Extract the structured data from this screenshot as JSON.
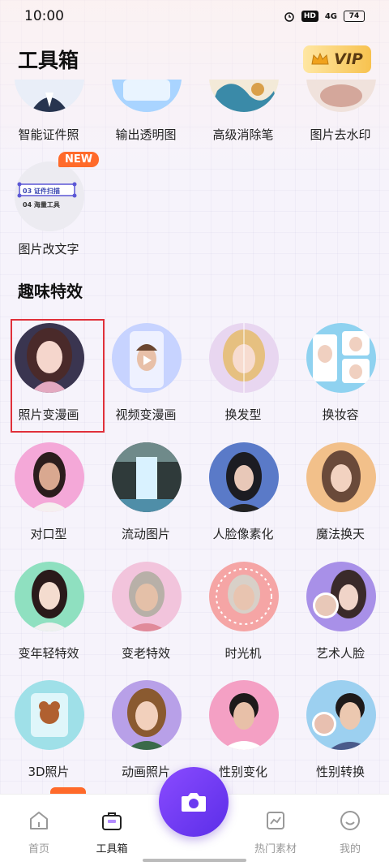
{
  "status_bar": {
    "time": "10:00",
    "hd": "HD",
    "signal": "4G",
    "battery": "74"
  },
  "header": {
    "title": "工具箱",
    "vip_label": "VIP"
  },
  "tools": [
    {
      "label": "智能证件照"
    },
    {
      "label": "输出透明图"
    },
    {
      "label": "高级消除笔"
    },
    {
      "label": "图片去水印"
    },
    {
      "label": "图片改文字",
      "badge": "NEW",
      "thumb_lines": [
        "03 证件扫描",
        "04 海量工具"
      ]
    }
  ],
  "fun_section": {
    "title": "趣味特效",
    "items": [
      {
        "label": "照片变漫画",
        "selected": true
      },
      {
        "label": "视频变漫画"
      },
      {
        "label": "换发型"
      },
      {
        "label": "换妆容"
      },
      {
        "label": "对口型"
      },
      {
        "label": "流动图片"
      },
      {
        "label": "人脸像素化"
      },
      {
        "label": "魔法换天"
      },
      {
        "label": "变年轻特效"
      },
      {
        "label": "变老特效"
      },
      {
        "label": "时光机"
      },
      {
        "label": "艺术人脸"
      },
      {
        "label": "3D照片"
      },
      {
        "label": "动画照片"
      },
      {
        "label": "性别变化"
      },
      {
        "label": "性别转换"
      }
    ]
  },
  "tabbar": {
    "tabs": [
      {
        "label": "首页",
        "icon": "home-icon"
      },
      {
        "label": "工具箱",
        "icon": "toolbox-icon",
        "active": true
      },
      {
        "label": "热门素材",
        "icon": "image-icon"
      },
      {
        "label": "我的",
        "icon": "smile-icon"
      }
    ],
    "camera_icon": "camera-icon"
  },
  "colors": {
    "accent": "#6a3af0",
    "vip_gold": "#f7c24f",
    "highlight": "#e0303a",
    "new_badge": "#ff6a2a"
  }
}
